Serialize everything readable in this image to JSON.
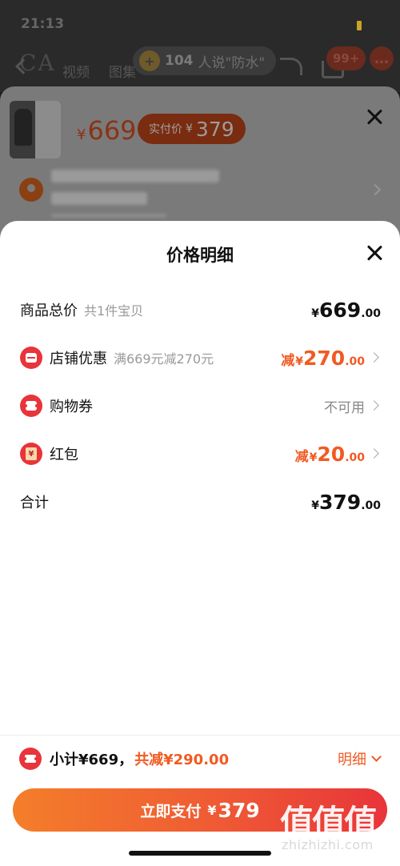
{
  "background": {
    "status_time": "21:13",
    "watermark_text": "CA",
    "tabs": [
      "视频",
      "图集"
    ],
    "question_pill": {
      "count": "104",
      "text": "人说\"防水\"",
      "icon": "lock-badge-icon"
    },
    "cart_badge": "99+",
    "sku_sheet": {
      "price_currency": "¥",
      "price": "669",
      "real_price_label": "实付价",
      "real_price_currency": "¥",
      "real_price": "379",
      "address_icon": "location-pin-icon"
    }
  },
  "sheet": {
    "title": "价格明细",
    "rows": [
      {
        "label": "商品总价",
        "sub": "共1件宝贝",
        "currency": "¥",
        "int": "669",
        "dec": ".00",
        "prefix": ""
      },
      {
        "label": "店铺优惠",
        "sub": "满669元减270元",
        "currency": "¥",
        "int": "270",
        "dec": ".00",
        "prefix": "减",
        "icon": "shop-icon"
      },
      {
        "label": "购物券",
        "sub": "",
        "value_text": "不可用",
        "icon": "coupon-icon"
      },
      {
        "label": "红包",
        "sub": "",
        "currency": "¥",
        "int": "20",
        "dec": ".00",
        "prefix": "减",
        "icon": "red-packet-icon"
      },
      {
        "label": "合计",
        "sub": "",
        "currency": "¥",
        "int": "379",
        "dec": ".00",
        "prefix": ""
      }
    ]
  },
  "footer": {
    "subtotal_text": "小计¥669，",
    "saved_text": "共减¥290.00",
    "detail_label": "明细",
    "pay_label": "立即支付",
    "pay_currency": "¥",
    "pay_amount": "379"
  },
  "watermark": {
    "brand": "值值值",
    "domain": "zhizhizhi.com"
  },
  "colors": {
    "accent": "#f15a22",
    "danger": "#e8343a",
    "button_start": "#f47e2a",
    "button_end": "#e8343a"
  }
}
